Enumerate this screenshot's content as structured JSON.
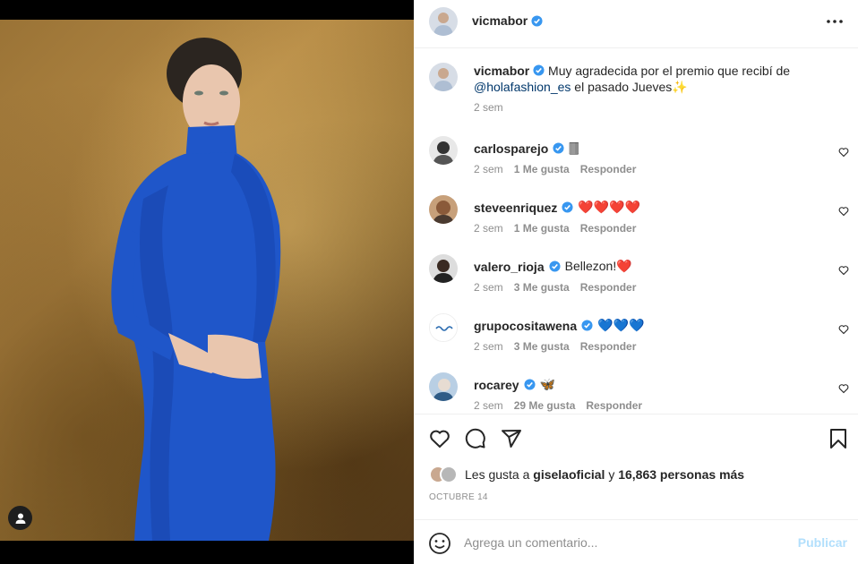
{
  "post": {
    "username": "vicmabor",
    "caption_text": "Muy agradecida por el premio que recibí de",
    "caption_mention": "@holafashion_es",
    "caption_end": "el pasado Jueves",
    "caption_emoji": "✨",
    "caption_time": "2 sem"
  },
  "comments": [
    {
      "username": "carlosparejo",
      "text": "",
      "emoji": "🀫",
      "time": "2 sem",
      "likes": "1 Me gusta",
      "reply": "Responder"
    },
    {
      "username": "steveenriquez",
      "text": "",
      "emoji": "❤️❤️❤️❤️",
      "time": "2 sem",
      "likes": "1 Me gusta",
      "reply": "Responder"
    },
    {
      "username": "valero_rioja",
      "text": "Bellezon!",
      "emoji": "❤️",
      "time": "2 sem",
      "likes": "3 Me gusta",
      "reply": "Responder"
    },
    {
      "username": "grupocositawena",
      "text": "",
      "emoji": "💙💙💙",
      "time": "2 sem",
      "likes": "3 Me gusta",
      "reply": "Responder"
    },
    {
      "username": "rocarey",
      "text": "",
      "emoji": "🦋",
      "time": "2 sem",
      "likes": "29 Me gusta",
      "reply": "Responder"
    }
  ],
  "likes": {
    "prefix": "Les gusta a",
    "user": "giselaoficial",
    "conj": "y",
    "count": "16,863 personas más"
  },
  "date": "OCTUBRE 14",
  "add_comment": {
    "placeholder": "Agrega un comentario...",
    "publish_label": "Publicar"
  },
  "colors": {
    "verified": "#3897f0",
    "link": "#00376b",
    "muted": "#8e8e8e",
    "publish_disabled": "#b2dffc",
    "dress": "#1f56c9"
  }
}
